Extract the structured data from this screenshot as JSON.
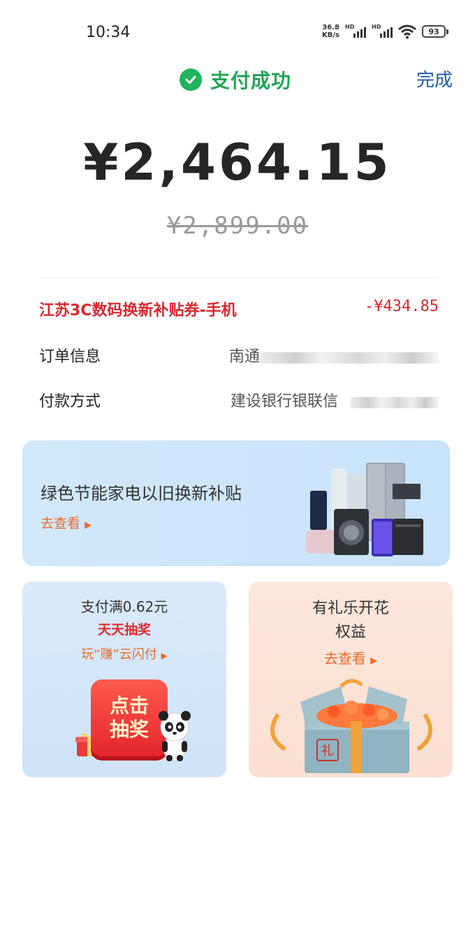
{
  "status_bar": {
    "time": "10:34",
    "speed_value": "36.8",
    "speed_unit": "KB/s",
    "sim1_label": "HD",
    "sim2_label": "HD",
    "battery": "93"
  },
  "header": {
    "success_text": "支付成功",
    "done_label": "完成",
    "success_color": "#1fa553"
  },
  "payment": {
    "paid_amount": "¥2,464.15",
    "original_amount": "¥2,899.00"
  },
  "details": {
    "coupon_label": "江苏3C数码换新补贴券-手机",
    "coupon_value": "-¥434.85",
    "order_label": "订单信息",
    "order_value": "南通",
    "method_label": "付款方式",
    "method_value": "建设银行银联信"
  },
  "banner": {
    "title": "绿色节能家电以旧换新补贴",
    "link": "去查看"
  },
  "card_left": {
    "line1": "支付满0.62元",
    "line2": "天天抽奖",
    "line3": "玩“赚”云闪付",
    "button_line1": "点击",
    "button_line2": "抽奖"
  },
  "card_right": {
    "line1": "有礼乐开花",
    "line2": "权益",
    "line3": "去查看",
    "box_char": "礼"
  },
  "colors": {
    "accent_red": "#d8282e",
    "link_orange": "#ee6a2c",
    "done_blue": "#1f5aa6"
  },
  "icons": [
    "check-circle-icon",
    "wifi-icon",
    "signal-icon",
    "battery-icon",
    "triangle-right-icon",
    "panda-icon",
    "gift-icon"
  ]
}
